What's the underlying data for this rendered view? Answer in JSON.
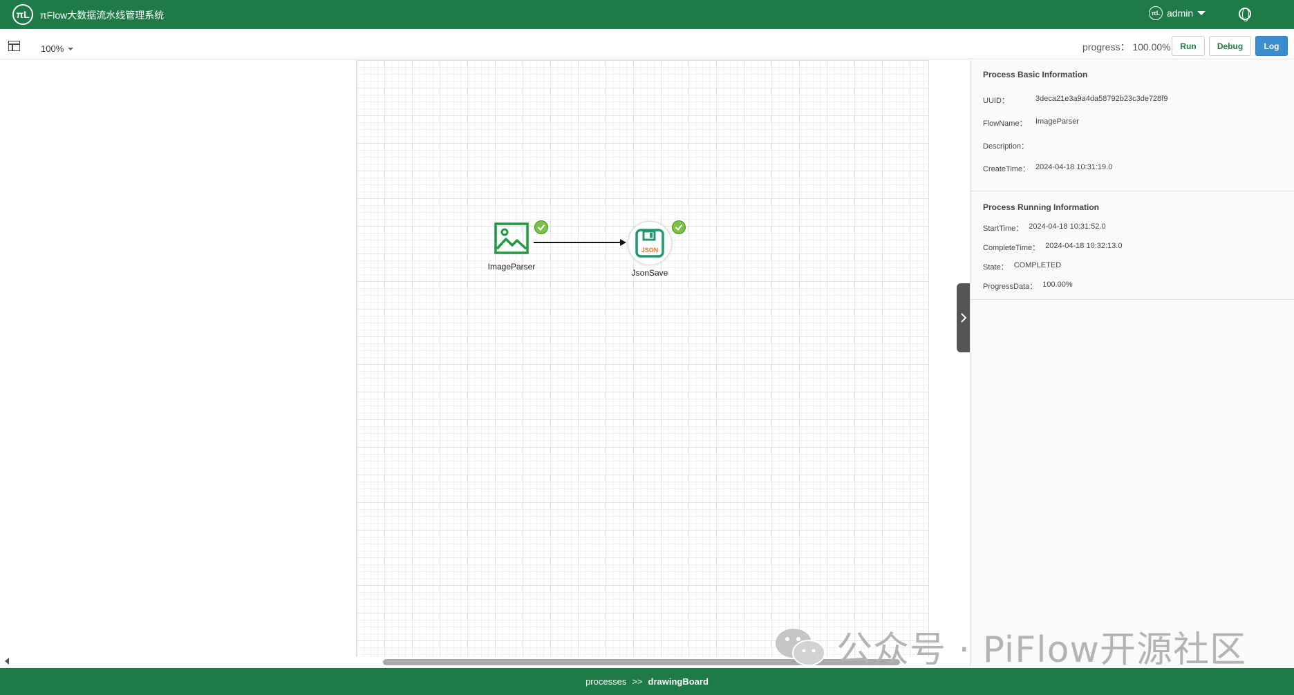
{
  "header": {
    "logo_text": "πL",
    "app_title": "πFlow大数据流水线管理系统",
    "user": "admin"
  },
  "toolbar": {
    "zoom": "100%",
    "progress_label": "progress",
    "progress_value": "100.00%",
    "run_label": "Run",
    "debug_label": "Debug",
    "log_label": "Log"
  },
  "canvas": {
    "nodes": [
      {
        "label": "ImageParser",
        "status": "completed"
      },
      {
        "label": "JsonSave",
        "status": "completed",
        "icon_text": "JSON"
      }
    ]
  },
  "panel": {
    "basic": {
      "title": "Process Basic Information",
      "uuid_label": "UUID：",
      "uuid": "3deca21e3a9a4da58792b23c3de728f9",
      "flowname_label": "FlowName：",
      "flowname": "ImageParser",
      "description_label": "Description：",
      "description": "",
      "createtime_label": "CreateTime：",
      "createtime": "2024-04-18 10:31:19.0"
    },
    "running": {
      "title": "Process Running Information",
      "starttime_label": "StartTime：",
      "starttime": "2024-04-18 10:31:52.0",
      "completetime_label": "CompleteTime：",
      "completetime": "2024-04-18 10:32:13.0",
      "state_label": "State：",
      "state": "COMPLETED",
      "progressdata_label": "ProgressData：",
      "progressdata": "100.00%"
    }
  },
  "watermark": "公众号 · PiFlow开源社区",
  "footer": {
    "crumb1": "processes",
    "separator": ">>",
    "crumb2": "drawingBoard"
  },
  "colors": {
    "brand": "#1e7a47",
    "log_button": "#3a8ed0",
    "check": "#7bc143"
  }
}
